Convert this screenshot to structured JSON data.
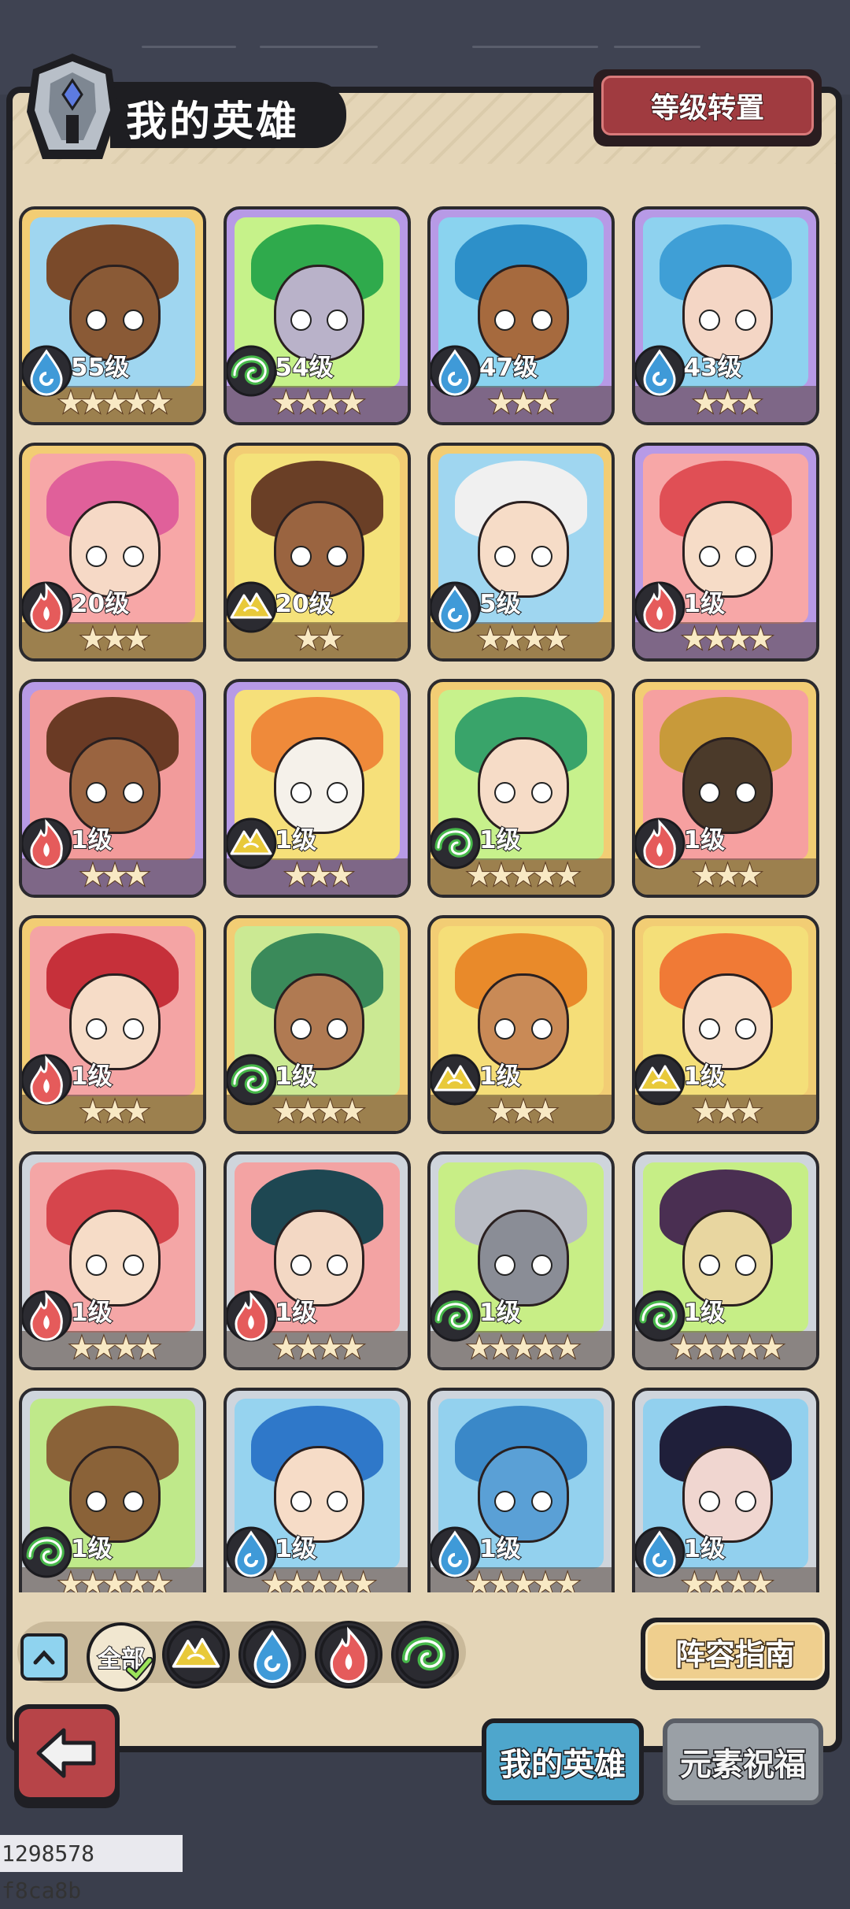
{
  "header": {
    "title": "我的英雄",
    "level_transfer_button": "等级转置"
  },
  "heroes": [
    {
      "level": "55级",
      "stars": 5,
      "element": "water",
      "frame": "gold",
      "bg": "#9fd6f0",
      "hair": "#7a4a2a",
      "skin": "#8a5a36"
    },
    {
      "level": "54级",
      "stars": 4,
      "element": "wind",
      "frame": "purple",
      "bg": "#c6f28a",
      "hair": "#2faa4c",
      "skin": "#b9b2c9"
    },
    {
      "level": "47级",
      "stars": 3,
      "element": "water",
      "frame": "purple",
      "bg": "#8ad3ef",
      "hair": "#2d90c9",
      "skin": "#a66a3e"
    },
    {
      "level": "43级",
      "stars": 3,
      "element": "water",
      "frame": "purple",
      "bg": "#8ed2ef",
      "hair": "#3f9fd6",
      "skin": "#f4d6c5"
    },
    {
      "level": "20级",
      "stars": 3,
      "element": "fire",
      "frame": "gold",
      "bg": "#f7a7a7",
      "hair": "#e0609a",
      "skin": "#f6d9c6"
    },
    {
      "level": "20级",
      "stars": 2,
      "element": "earth",
      "frame": "gold",
      "bg": "#f4e27a",
      "hair": "#6a3f26",
      "skin": "#9a6440"
    },
    {
      "level": "5级",
      "stars": 4,
      "element": "water",
      "frame": "gold",
      "bg": "#9fd6f0",
      "hair": "#f0f0f0",
      "skin": "#f6dcc7"
    },
    {
      "level": "1级",
      "stars": 4,
      "element": "fire",
      "frame": "purple",
      "bg": "#f7a7a7",
      "hair": "#e04f55",
      "skin": "#f6dcc7"
    },
    {
      "level": "1级",
      "stars": 3,
      "element": "fire",
      "frame": "purple",
      "bg": "#f29b9b",
      "hair": "#6a3a24",
      "skin": "#9a6440"
    },
    {
      "level": "1级",
      "stars": 3,
      "element": "earth",
      "frame": "purple",
      "bg": "#f6e07a",
      "hair": "#ef8a3a",
      "skin": "#f5f1ea"
    },
    {
      "level": "1级",
      "stars": 5,
      "element": "wind",
      "frame": "gold",
      "bg": "#c7f18c",
      "hair": "#39a46a",
      "skin": "#f6dcc7"
    },
    {
      "level": "1级",
      "stars": 3,
      "element": "fire",
      "frame": "gold",
      "bg": "#f6a0a0",
      "hair": "#c89a3a",
      "skin": "#4b3a2a"
    },
    {
      "level": "1级",
      "stars": 3,
      "element": "fire",
      "frame": "gold",
      "bg": "#f4a4a4",
      "hair": "#c6303a",
      "skin": "#f6dcc7"
    },
    {
      "level": "1级",
      "stars": 4,
      "element": "wind",
      "frame": "gold",
      "bg": "#cbe993",
      "hair": "#3a8a5a",
      "skin": "#b07a52"
    },
    {
      "level": "1级",
      "stars": 3,
      "element": "earth",
      "frame": "gold",
      "bg": "#f5de78",
      "hair": "#e98a2a",
      "skin": "#c98a56"
    },
    {
      "level": "1级",
      "stars": 3,
      "element": "earth",
      "frame": "gold",
      "bg": "#f4df79",
      "hair": "#f07a36",
      "skin": "#f6dcc7"
    },
    {
      "level": "1级",
      "stars": 4,
      "element": "fire",
      "frame": "silver",
      "bg": "#f4a6a6",
      "hair": "#d6454c",
      "skin": "#f6dcc7"
    },
    {
      "level": "1级",
      "stars": 4,
      "element": "fire",
      "frame": "silver",
      "bg": "#f3a3a3",
      "hair": "#1e4752",
      "skin": "#f3d8c4"
    },
    {
      "level": "1级",
      "stars": 5,
      "element": "wind",
      "frame": "silver",
      "bg": "#c8ee86",
      "hair": "#b9bcc4",
      "skin": "#8a8d96"
    },
    {
      "level": "1级",
      "stars": 5,
      "element": "wind",
      "frame": "silver",
      "bg": "#c6ee86",
      "hair": "#4a2f52",
      "skin": "#e8d6a0"
    },
    {
      "level": "1级",
      "stars": 5,
      "element": "wind",
      "frame": "silver",
      "bg": "#bfe98a",
      "hair": "#8a6238",
      "skin": "#8a6238"
    },
    {
      "level": "1级",
      "stars": 5,
      "element": "water",
      "frame": "silver",
      "bg": "#96d3ef",
      "hair": "#2f78c9",
      "skin": "#f6dcc7"
    },
    {
      "level": "1级",
      "stars": 5,
      "element": "water",
      "frame": "silver",
      "bg": "#93d1ee",
      "hair": "#3a88c8",
      "skin": "#5aa0d6"
    },
    {
      "level": "1级",
      "stars": 4,
      "element": "water",
      "frame": "silver",
      "bg": "#92d0ee",
      "hair": "#1f1f3a",
      "skin": "#f0d6d0"
    }
  ],
  "filters": {
    "all_label": "全部",
    "icons": [
      "earth-icon",
      "water-icon",
      "fire-icon",
      "wind-icon"
    ]
  },
  "buttons": {
    "lineup_guide": "阵容指南",
    "back": "back-arrow-icon"
  },
  "tabs": {
    "my_heroes": "我的英雄",
    "element_blessing": "元素祝福"
  },
  "footer_id": "1298578 f8ca8b",
  "colors": {
    "fire": "#e55b5b",
    "water": "#3f9ad8",
    "wind": "#47b84a",
    "earth": "#e8c93a",
    "gold_frame": "#f2cd74",
    "purple_frame": "#b79ae6",
    "silver_frame": "#cfd5dc"
  }
}
